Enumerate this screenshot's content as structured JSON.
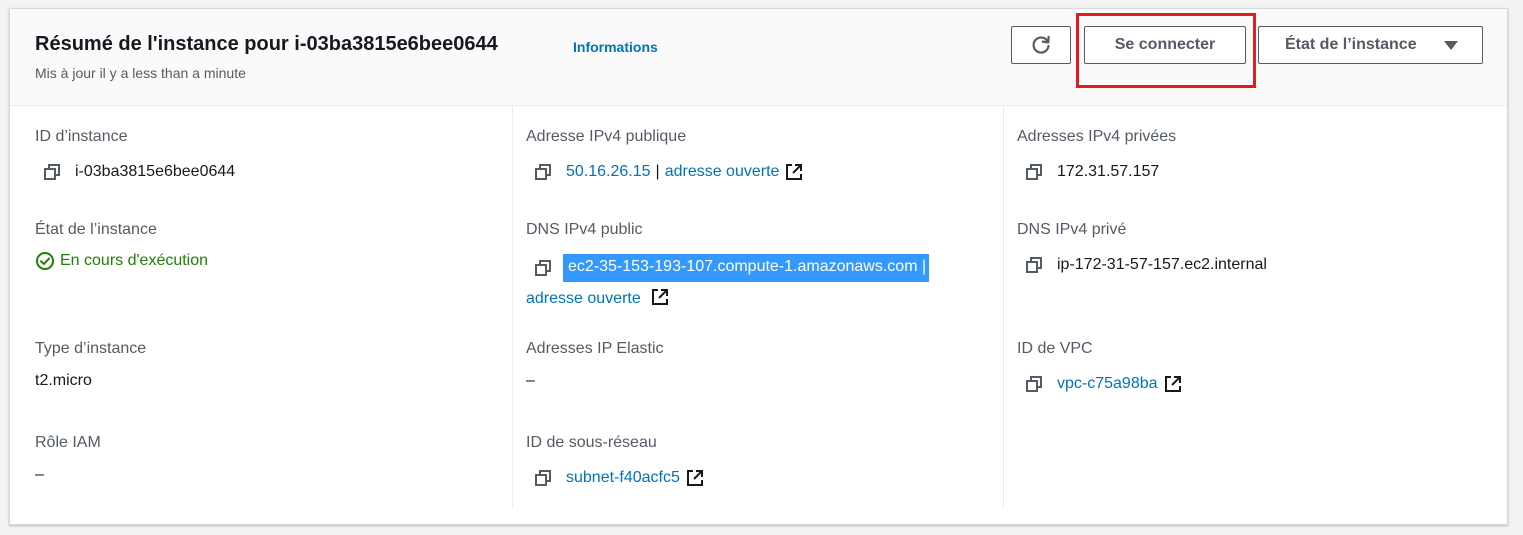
{
  "header": {
    "title": "Résumé de l'instance pour i-03ba3815e6bee0644",
    "info_link": "Informations",
    "subtitle": "Mis à jour il y a less than a minute",
    "connect_label": "Se connecter",
    "state_label": "État de l’instance"
  },
  "colors": {
    "link": "#0073bb",
    "status_running": "#1d8102",
    "highlight_box": "#e31b23",
    "selection": "#3399ff"
  },
  "col1": {
    "instance_id_label": "ID d’instance",
    "instance_id": "i-03ba3815e6bee0644",
    "state_label": "État de l’instance",
    "state_value": "En cours d'exécution",
    "type_label": "Type d’instance",
    "type_value": "t2.micro",
    "iam_label": "Rôle IAM",
    "iam_value": "–"
  },
  "col2": {
    "ipv4_label": "Adresse IPv4 publique",
    "ipv4_value": "50.16.26.15",
    "ipv4_sep": "|",
    "open_link": "adresse ouverte",
    "dns_label": "DNS IPv4 public",
    "dns_value": "ec2-35-153-193-107.compute-1.amazonaws.com",
    "dns_sep": "|",
    "dns_open_link": "adresse ouverte",
    "elastic_label": "Adresses IP Elastic",
    "elastic_value": "–",
    "subnet_label": "ID de sous-réseau",
    "subnet_value": "subnet-f40acfc5"
  },
  "col3": {
    "private_ipv4_label": "Adresses IPv4 privées",
    "private_ipv4_value": "172.31.57.157",
    "private_dns_label": "DNS IPv4 privé",
    "private_dns_value": "ip-172-31-57-157.ec2.internal",
    "vpc_label": "ID de VPC",
    "vpc_value": "vpc-c75a98ba"
  },
  "icons": {
    "refresh": "refresh-icon",
    "copy": "copy-icon",
    "external": "external-link-icon",
    "status": "check-circle-icon",
    "caret": "caret-down-icon"
  }
}
